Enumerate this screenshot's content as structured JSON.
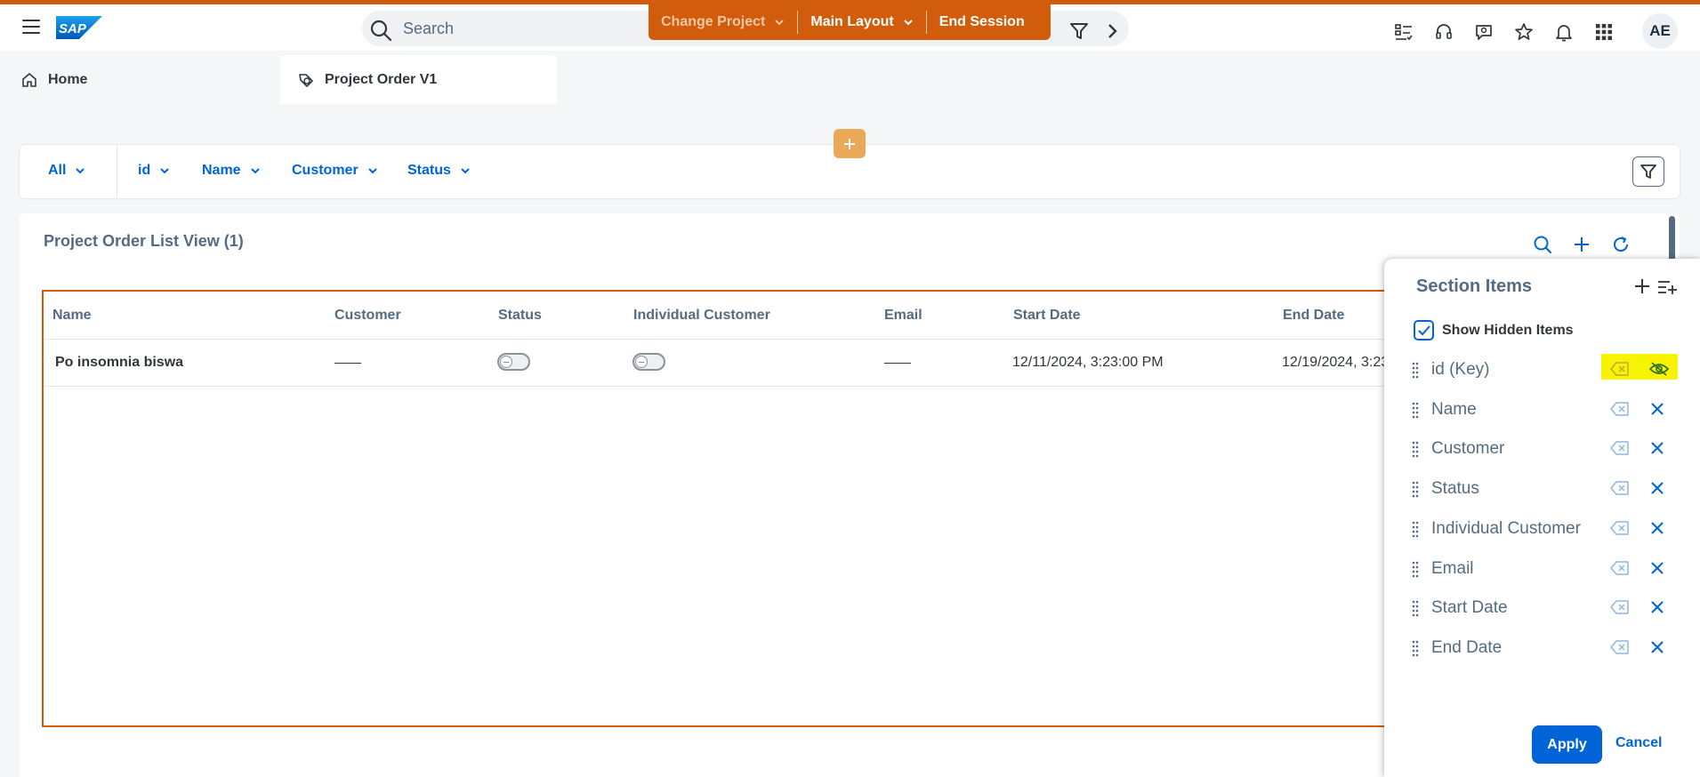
{
  "shell": {
    "logo": "SAP",
    "search_placeholder": "Search",
    "change_project": "Change Project",
    "main_layout": "Main Layout",
    "end_session": "End Session",
    "avatar_initials": "AE"
  },
  "tabs": [
    {
      "label": "Home",
      "icon": "home-icon"
    },
    {
      "label": "Project Order V1",
      "icon": "object-icon"
    }
  ],
  "filters": [
    "All",
    "id",
    "Name",
    "Customer",
    "Status"
  ],
  "list": {
    "title": "Project Order List View (1)",
    "columns": [
      "Name",
      "Customer",
      "Status",
      "Individual Customer",
      "Email",
      "Start Date",
      "End Date"
    ],
    "rows": [
      {
        "name": "Po insomnia biswa",
        "start_date": "12/11/2024, 3:23:00 PM",
        "end_date": "12/19/2024, 3:23"
      }
    ]
  },
  "section_items": {
    "title": "Section Items",
    "show_hidden_label": "Show Hidden Items",
    "show_hidden_checked": true,
    "items": [
      "id (Key)",
      "Name",
      "Customer",
      "Status",
      "Individual Customer",
      "Email",
      "Start Date",
      "End Date"
    ],
    "apply_label": "Apply",
    "cancel_label": "Cancel"
  },
  "colors": {
    "accent": "#0064d9",
    "brand_orange": "#d15c0b",
    "highlight": "#f8f400"
  }
}
